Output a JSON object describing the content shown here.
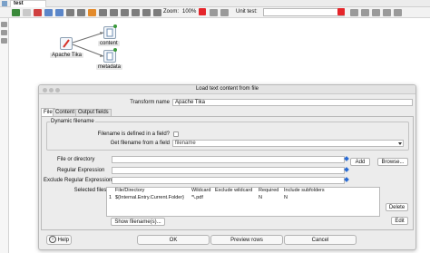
{
  "tab": {
    "title": "test"
  },
  "toolbar": {
    "zoom_label": "Zoom:",
    "zoom_value": "100%",
    "unit_test_label": "Unit test:"
  },
  "canvas": {
    "steps": [
      {
        "label": "Apache Tika"
      },
      {
        "label": "content"
      },
      {
        "label": "metadata"
      }
    ]
  },
  "dialog": {
    "title": "Load text content from file",
    "transform_name_label": "Transform name",
    "transform_name_value": "Apache Tika",
    "tabs": [
      "File",
      "Content",
      "Output fields"
    ],
    "dynamic_group_title": "Dynamic filename",
    "filename_in_field_label": "Filename is defined in a field?",
    "get_filename_label": "Get filename from a field",
    "get_filename_value": "filename",
    "file_or_directory_label": "File or directory",
    "regex_label": "Regular Expression",
    "exclude_regex_label": "Exclude Regular Expression",
    "add_button": "Add",
    "browse_button": "Browse...",
    "selected_files_label": "Selected files:",
    "table": {
      "columns": [
        "File/Directory",
        "Wildcard",
        "Exclude wildcard",
        "Required",
        "Include subfolders"
      ],
      "rows": [
        {
          "num": "1",
          "file": "${Internal.Entry.Current.Folder}",
          "wildcard": "*\\.pdf",
          "exclude": "",
          "required": "N",
          "subfolders": "N"
        }
      ]
    },
    "delete_button": "Delete",
    "edit_button": "Edit",
    "show_filenames_button": "Show filename(s)...",
    "help_button": "Help",
    "ok_button": "OK",
    "preview_button": "Preview rows",
    "cancel_button": "Cancel"
  },
  "colors": {
    "accent_red": "#e5252a",
    "link_blue": "#2a6bd3"
  }
}
